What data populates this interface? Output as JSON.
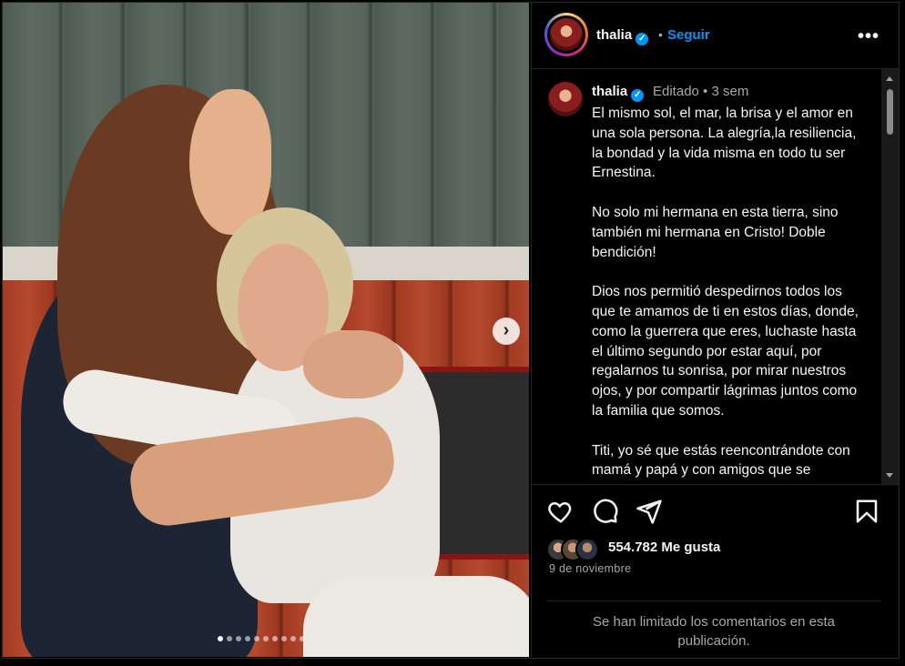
{
  "post": {
    "username": "thalia",
    "follow_label": "Seguir",
    "separator": "•",
    "more_label": "•••"
  },
  "caption": {
    "username": "thalia",
    "meta": "Editado  •  3 sem",
    "text": "El mismo sol, el mar, la brisa y el amor en una sola persona. La alegría,la resiliencia, la bondad y la vida misma en todo tu ser Ernestina.\n\nNo solo mi hermana en esta tierra, sino también mi hermana en Cristo! Doble bendición!\n\nDios nos permitió despedirnos todos los que te amamos de ti en estos días, donde, como la guerrera que eres, luchaste hasta el último segundo por estar aquí, por regalarnos tu sonrisa, por mirar nuestros ojos, y por compartir lágrimas juntos como la familia que somos.\n\nTiti, yo sé que estás reencontrándote con mamá y papá y con amigos que se"
  },
  "media": {
    "next_label": "›",
    "carousel_count": 10,
    "carousel_active_index": 0
  },
  "stats": {
    "likes": "554.782 Me gusta",
    "date": "9 de noviembre",
    "comments_limited": "Se han limitado los comentarios en esta publicación."
  },
  "icons": [
    "heart-icon",
    "comment-icon",
    "share-icon",
    "save-icon",
    "verified-icon",
    "more-icon"
  ],
  "colors": {
    "accent": "#0095f6",
    "background": "#000000",
    "text": "#f5f5f5",
    "secondary_text": "#a8a8a8"
  }
}
